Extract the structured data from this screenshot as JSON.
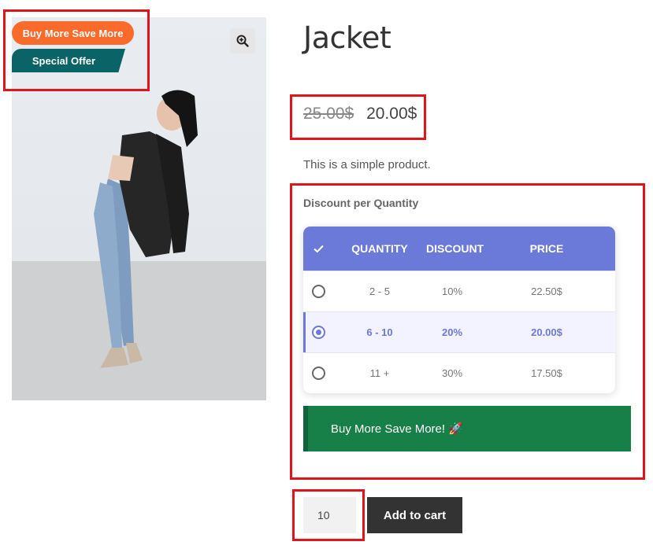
{
  "badges": {
    "primary": "Buy More Save More",
    "secondary": "Special Offer"
  },
  "product": {
    "title": "Jacket",
    "price_old": "25.00$",
    "price_new": "20.00$",
    "short_description": "This is a simple product."
  },
  "discount_table": {
    "heading": "Discount per Quantity",
    "columns": [
      "QUANTITY",
      "DISCOUNT",
      "PRICE"
    ],
    "header_icon": "check-icon",
    "selected_index": 1,
    "rows": [
      {
        "quantity": "2 - 5",
        "discount": "10%",
        "price": "22.50$"
      },
      {
        "quantity": "6 - 10",
        "discount": "20%",
        "price": "20.00$"
      },
      {
        "quantity": "11 +",
        "discount": "30%",
        "price": "17.50$"
      }
    ]
  },
  "promo": {
    "text": "Buy More Save More! 🚀",
    "icon": "rocket-icon"
  },
  "cart": {
    "quantity": "10",
    "add_label": "Add to cart"
  },
  "colors": {
    "accent": "#6b79d9",
    "badge_orange": "#fa6a2b",
    "badge_teal": "#0a6367",
    "promo_green": "#168048",
    "highlight_box": "#e0141a"
  }
}
